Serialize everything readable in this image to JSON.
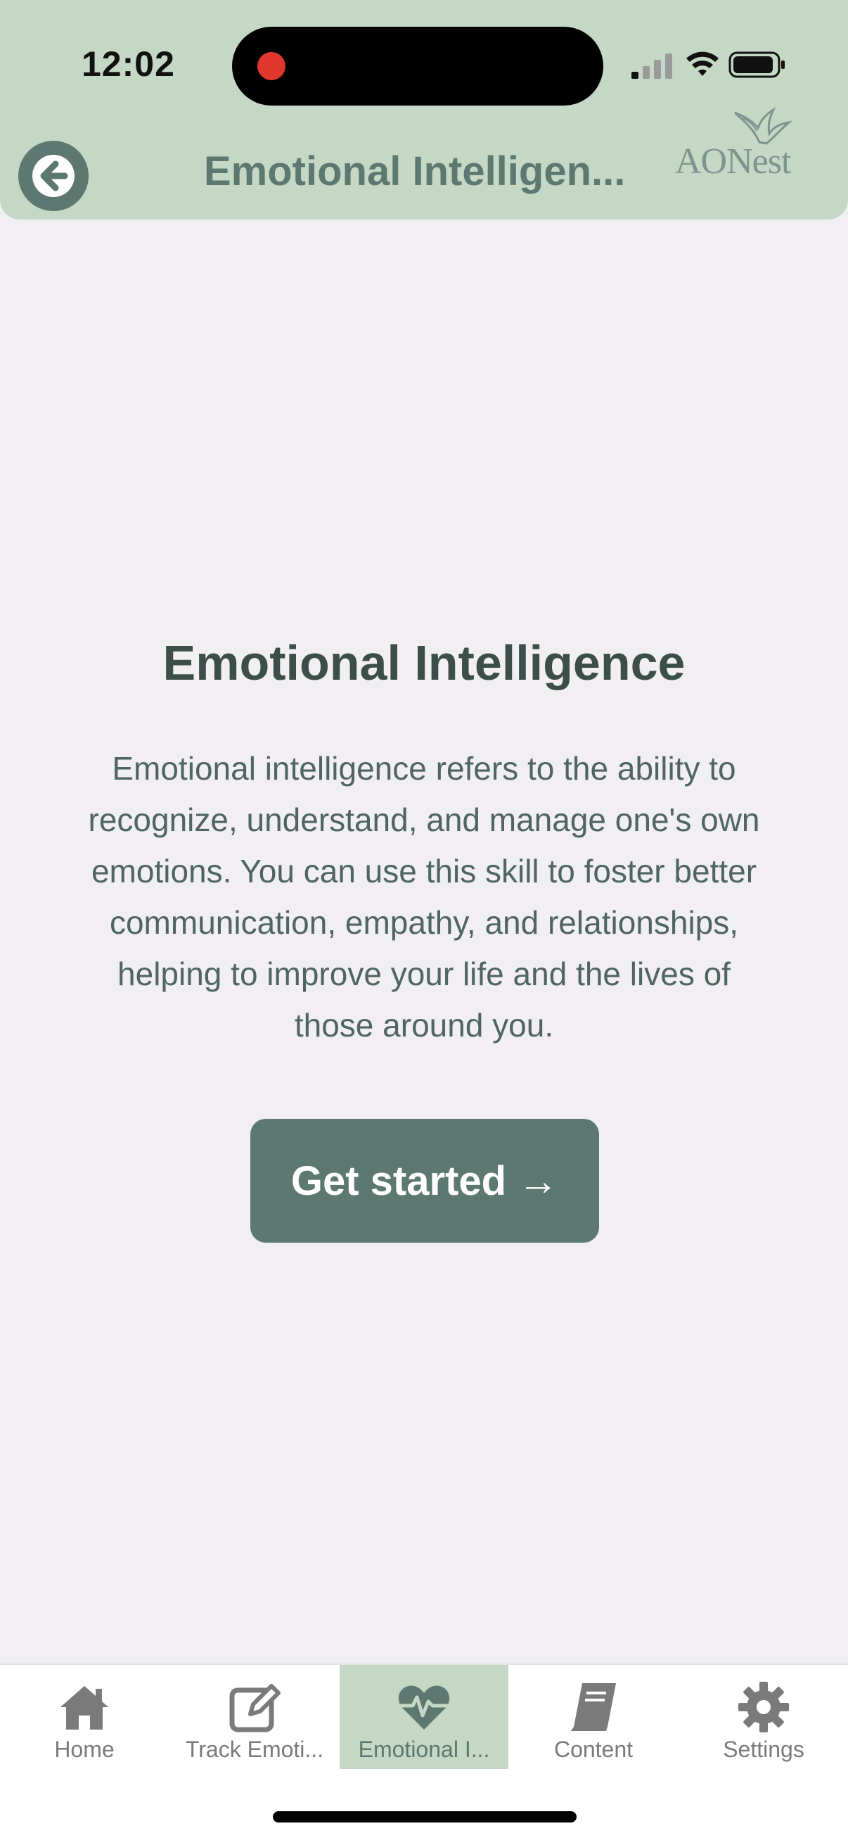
{
  "status_bar": {
    "time": "12:02"
  },
  "header": {
    "title": "Emotional Intelligen...",
    "logo_text": "AONest"
  },
  "main": {
    "title": "Emotional Intelligence",
    "description": "Emotional intelligence refers to the ability to recognize, understand, and manage one's own emotions. You can use this skill to foster better communication, empathy, and relationships, helping to improve your life and the lives of those around you.",
    "cta_label": "Get started →"
  },
  "tabbar": {
    "items": [
      {
        "label": "Home",
        "icon": "home-icon",
        "active": false
      },
      {
        "label": "Track Emoti...",
        "icon": "edit-icon",
        "active": false
      },
      {
        "label": "Emotional I...",
        "icon": "heartbeat-icon",
        "active": true
      },
      {
        "label": "Content",
        "icon": "book-icon",
        "active": false
      },
      {
        "label": "Settings",
        "icon": "gear-icon",
        "active": false
      }
    ]
  },
  "colors": {
    "header_bg": "#c4d8c5",
    "accent": "#5d7871",
    "page_bg": "#f1eff2",
    "title_text": "#3d4e49"
  }
}
